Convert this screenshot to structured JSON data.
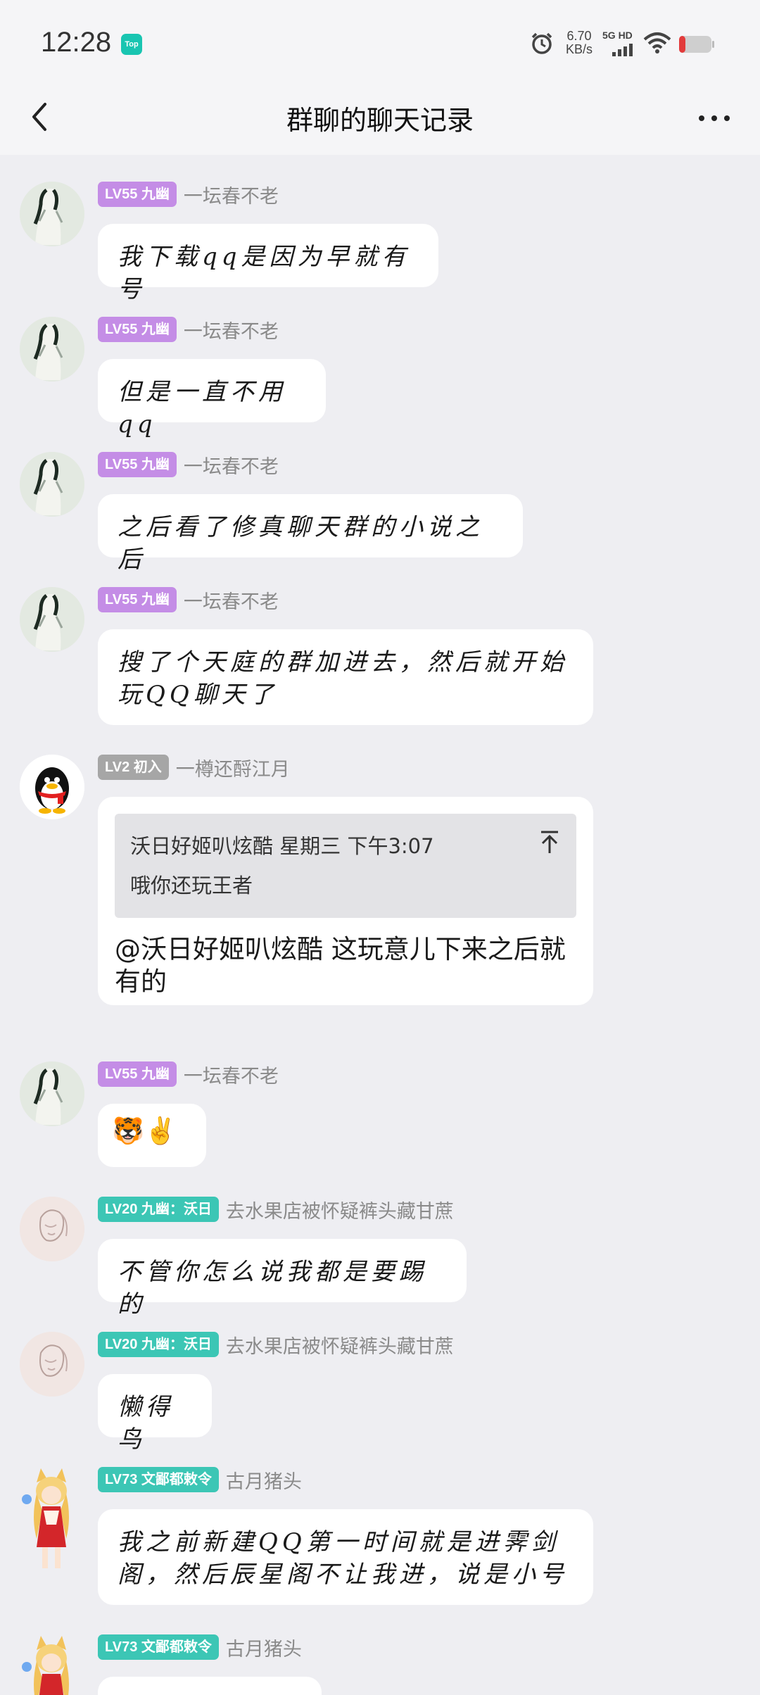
{
  "status_bar": {
    "time": "12:28",
    "app_badge": "Top",
    "speed_value": "6.70",
    "speed_unit": "KB/s",
    "network": "5G HD"
  },
  "header": {
    "title": "群聊的聊天记录"
  },
  "messages": [
    {
      "badge": "LV55 九幽",
      "name": "一坛春不老",
      "text": "我下载qq是因为早就有号"
    },
    {
      "badge": "LV55 九幽",
      "name": "一坛春不老",
      "text": "但是一直不用qq"
    },
    {
      "badge": "LV55 九幽",
      "name": "一坛春不老",
      "text": "之后看了修真聊天群的小说之后"
    },
    {
      "badge": "LV55 九幽",
      "name": "一坛春不老",
      "text": "搜了个天庭的群加进去，然后就开始玩QQ聊天了"
    },
    {
      "badge": "LV2 初入",
      "name": "一樽还酹江月",
      "quote": {
        "sender": "沃日好姬叭炫酷",
        "time": "星期三 下午3:07",
        "text": "哦你还玩王者"
      },
      "text": "@沃日好姬叭炫酷 这玩意儿下来之后就有的"
    },
    {
      "badge": "LV55 九幽",
      "name": "一坛春不老",
      "text": "🐯✌️"
    },
    {
      "badge": "LV20 九幽：沃日",
      "name": "去水果店被怀疑裤头藏甘蔗",
      "text": "不管你怎么说我都是要踢的"
    },
    {
      "badge": "LV20 九幽：沃日",
      "name": "去水果店被怀疑裤头藏甘蔗",
      "text": "懒得鸟"
    },
    {
      "badge": "LV73 文鄙都敕令",
      "name": "古月猪头",
      "text": "我之前新建QQ第一时间就是进霁剑阁，然后辰星阁不让我进，说是小号"
    },
    {
      "badge": "LV73 文鄙都敕令",
      "name": "古月猪头"
    }
  ],
  "colors": {
    "badge_purple": "#c48de6",
    "badge_gray": "#a6a6a6",
    "badge_teal": "#3cc6b5",
    "background": "#eeeef2"
  },
  "icons": [
    "back-icon",
    "more-icon",
    "alarm-icon",
    "wifi-icon",
    "battery-icon",
    "jump-to-message-icon"
  ]
}
